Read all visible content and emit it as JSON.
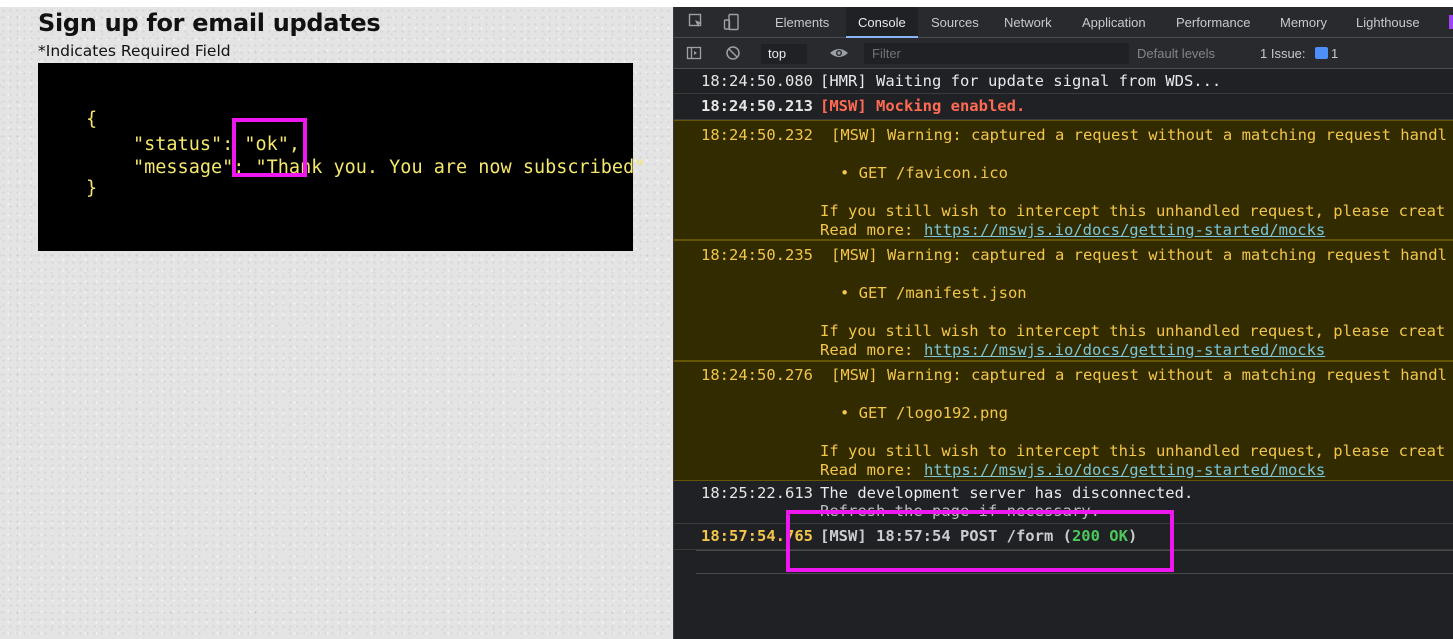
{
  "page": {
    "title": "Sign up for email updates",
    "required_note": "*Indicates Required Field",
    "response_json": {
      "open": "{",
      "status_line": "\"status\": \"ok\",",
      "message_line": "\"message\": \"Thank you. You are now subscribed\"",
      "close": "}"
    }
  },
  "devtools": {
    "tabs": [
      "Elements",
      "Console",
      "Sources",
      "Network",
      "Application",
      "Performance",
      "Memory",
      "Lighthouse"
    ],
    "active_tab": "Console",
    "toolbar": {
      "context": "top",
      "filter_placeholder": "Filter",
      "levels": "Default levels",
      "issues_label": "1 Issue:",
      "issues_count": "1"
    },
    "messages": [
      {
        "time": "18:24:50.080",
        "text": "[HMR] Waiting for update signal from WDS..."
      },
      {
        "time": "18:24:50.213",
        "text": "[MSW] Mocking enabled."
      },
      {
        "time": "18:24:50.232",
        "text": "[MSW] Warning: captured a request without a matching request handl",
        "request": "• GET /favicon.ico",
        "hint": "If you still wish to intercept this unhandled request, please creat",
        "read_more": "Read more:",
        "link": "https://mswjs.io/docs/getting-started/mocks"
      },
      {
        "time": "18:24:50.235",
        "text": "[MSW] Warning: captured a request without a matching request handl",
        "request": "• GET /manifest.json",
        "hint": "If you still wish to intercept this unhandled request, please creat",
        "read_more": "Read more:",
        "link": "https://mswjs.io/docs/getting-started/mocks"
      },
      {
        "time": "18:24:50.276",
        "text": "[MSW] Warning: captured a request without a matching request handl",
        "request": "• GET /logo192.png",
        "hint": "If you still wish to intercept this unhandled request, please creat",
        "read_more": "Read more:",
        "link": "https://mswjs.io/docs/getting-started/mocks"
      },
      {
        "time": "18:25:22.613",
        "text": "The development server has disconnected.",
        "text2": "Refresh the page if necessary."
      },
      {
        "time": "18:57:54.765",
        "text_prefix": "[MSW] 18:57:54 POST /form (",
        "status": "200 OK",
        "text_suffix": ")"
      }
    ]
  },
  "colors": {
    "highlight": "#ef17ef",
    "json_text": "#f5e76c",
    "warning_bg": "#332b00",
    "warning_text": "#f2c54b",
    "msw_red": "#ff6b52",
    "status_green": "#4ec85b"
  }
}
